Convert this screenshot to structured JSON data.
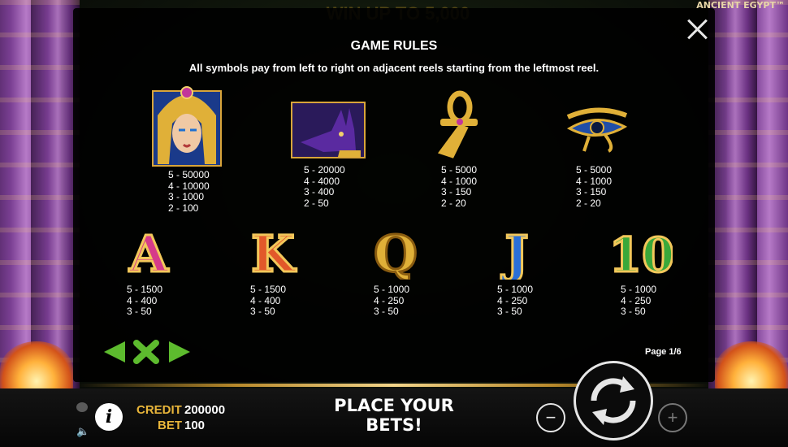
{
  "background": {
    "header_text": "WIN UP TO 5,000",
    "brand": "ANCIENT EGYPT™"
  },
  "modal": {
    "title": "GAME RULES",
    "subtitle": "All symbols pay from left to right on adjacent reels starting from the leftmost reel.",
    "page_indicator": "Page 1/6"
  },
  "symbols": [
    {
      "name": "cleopatra",
      "pays": [
        "5 - 50000",
        "4 - 10000",
        "3 - 1000",
        "2 - 100"
      ]
    },
    {
      "name": "anubis",
      "pays": [
        "5 - 20000",
        "4 - 4000",
        "3 - 400",
        "2 - 50"
      ]
    },
    {
      "name": "ankh",
      "pays": [
        "5 - 5000",
        "4 - 1000",
        "3 - 150",
        "2 - 20"
      ]
    },
    {
      "name": "eye-of-horus",
      "pays": [
        "5 - 5000",
        "4 - 1000",
        "3 - 150",
        "2 - 20"
      ]
    },
    {
      "name": "A",
      "label": "A",
      "pays": [
        "5 - 1500",
        "4 - 400",
        "3 - 50"
      ]
    },
    {
      "name": "K",
      "label": "K",
      "pays": [
        "5 - 1500",
        "4 - 400",
        "3 - 50"
      ]
    },
    {
      "name": "Q",
      "label": "Q",
      "pays": [
        "5 - 1000",
        "4 - 250",
        "3 - 50"
      ]
    },
    {
      "name": "J",
      "label": "J",
      "pays": [
        "5 - 1000",
        "4 - 250",
        "3 - 50"
      ]
    },
    {
      "name": "10",
      "label": "10",
      "pays": [
        "5 - 1000",
        "4 - 250",
        "3 - 50"
      ]
    }
  ],
  "nav": {
    "prev_icon": "arrow-left-icon",
    "close_icon": "x-icon",
    "next_icon": "arrow-right-icon"
  },
  "bottom_bar": {
    "credit_label": "CREDIT",
    "credit_value": "200000",
    "bet_label": "BET",
    "bet_value": "100",
    "message": "PLACE YOUR BETS!",
    "info_label": "i",
    "minus_label": "−",
    "plus_label": "+"
  },
  "colors": {
    "gold": "#e8b53a",
    "nav_green": "#5dbb2e",
    "panel_bg": "#000000"
  }
}
